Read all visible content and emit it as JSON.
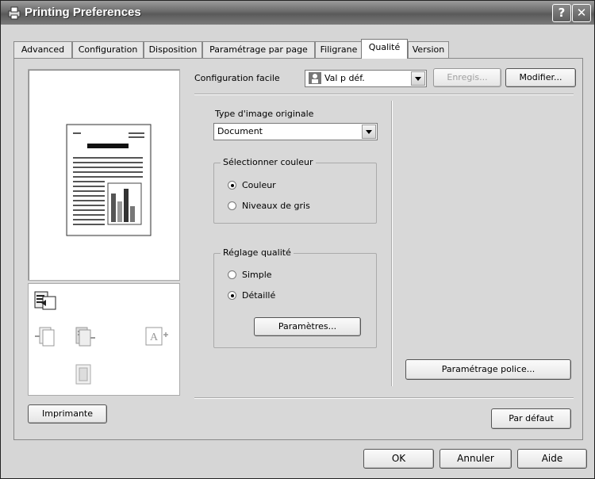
{
  "window": {
    "title": "Printing Preferences",
    "help_button": "?",
    "close_button": "✕"
  },
  "tabs": [
    "Advanced",
    "Configuration",
    "Disposition",
    "Paramétrage par page",
    "Filigrane",
    "Qualité",
    "Version"
  ],
  "active_tab": "Qualité",
  "easy_setup": {
    "label": "Configuration facile",
    "value": "Val p déf.",
    "save_label": "Enregis...",
    "modify_label": "Modifier..."
  },
  "original_image_type": {
    "label": "Type d'image originale",
    "value": "Document"
  },
  "color_group": {
    "legend": "Sélectionner couleur",
    "options": [
      "Couleur",
      "Niveaux de gris"
    ],
    "selected": "Couleur"
  },
  "quality_group": {
    "legend": "Réglage qualité",
    "options": [
      "Simple",
      "Détaillé"
    ],
    "selected": "Détaillé",
    "params_label": "Paramètres..."
  },
  "font_settings_label": "Paramétrage police...",
  "printer_button_label": "Imprimante",
  "default_button_label": "Par défaut",
  "footer": {
    "ok": "OK",
    "cancel": "Annuler",
    "help": "Aide"
  }
}
